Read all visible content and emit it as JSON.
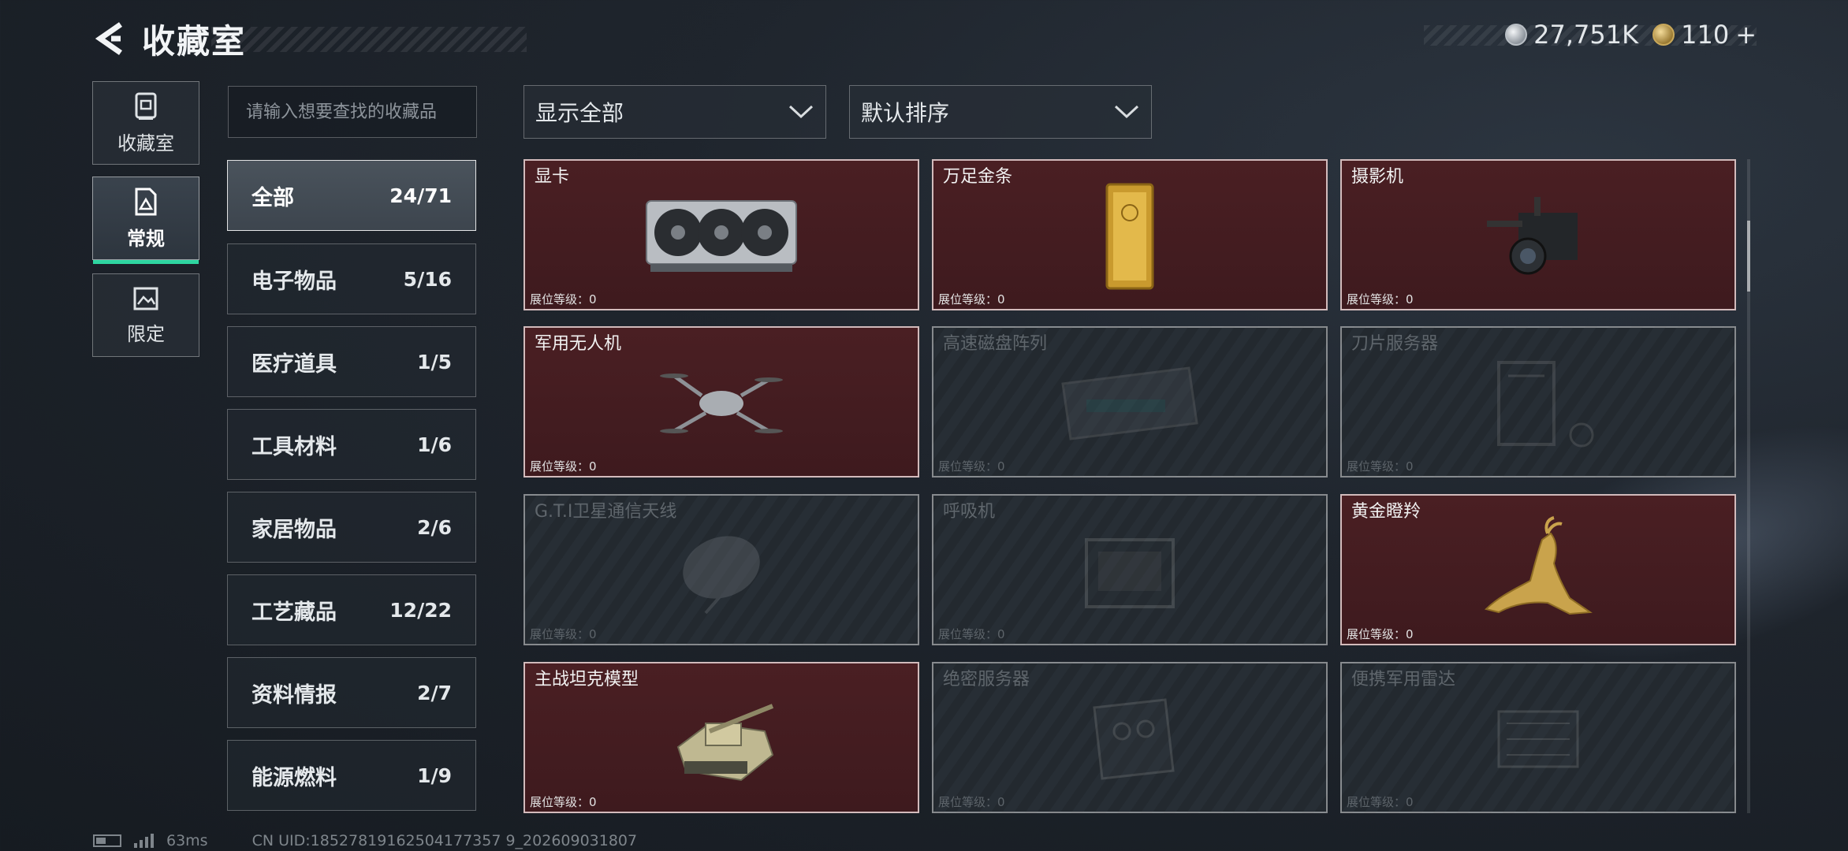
{
  "header": {
    "title": "收藏室",
    "back_icon": "back-arrow-icon"
  },
  "currency": [
    {
      "icon": "silver-coin-icon",
      "value": "27,751K"
    },
    {
      "icon": "gold-coin-icon",
      "value": "110",
      "add_symbol": "+"
    }
  ],
  "left_tabs": [
    {
      "label": "收藏室",
      "icon": "vault-icon",
      "active": false
    },
    {
      "label": "常规",
      "icon": "document-icon",
      "active": true
    },
    {
      "label": "限定",
      "icon": "picture-icon",
      "active": false
    }
  ],
  "search": {
    "placeholder": "请输入想要查找的收藏品"
  },
  "categories": [
    {
      "name": "全部",
      "count": "24/71",
      "active": true
    },
    {
      "name": "电子物品",
      "count": "5/16"
    },
    {
      "name": "医疗道具",
      "count": "1/5"
    },
    {
      "name": "工具材料",
      "count": "1/6"
    },
    {
      "name": "家居物品",
      "count": "2/6"
    },
    {
      "name": "工艺藏品",
      "count": "12/22"
    },
    {
      "name": "资料情报",
      "count": "2/7"
    },
    {
      "name": "能源燃料",
      "count": "1/9"
    }
  ],
  "filters": {
    "display": {
      "value": "显示全部",
      "icon": "chevron-down-icon"
    },
    "sort": {
      "value": "默认排序",
      "icon": "chevron-down-icon"
    }
  },
  "level_label": "展位等级：",
  "items": [
    {
      "name": "显卡",
      "level": "0",
      "owned": true,
      "icon": "graphics-card-icon"
    },
    {
      "name": "万足金条",
      "level": "0",
      "owned": true,
      "icon": "gold-bar-icon"
    },
    {
      "name": "摄影机",
      "level": "0",
      "owned": true,
      "icon": "video-camera-icon"
    },
    {
      "name": "军用无人机",
      "level": "0",
      "owned": true,
      "icon": "drone-icon"
    },
    {
      "name": "高速磁盘阵列",
      "level": "0",
      "owned": false,
      "icon": "disk-array-icon"
    },
    {
      "name": "刀片服务器",
      "level": "0",
      "owned": false,
      "icon": "blade-server-icon"
    },
    {
      "name": "G.T.I卫星通信天线",
      "level": "0",
      "owned": false,
      "icon": "satellite-dish-icon"
    },
    {
      "name": "呼吸机",
      "level": "0",
      "owned": false,
      "icon": "ventilator-icon"
    },
    {
      "name": "黄金瞪羚",
      "level": "0",
      "owned": true,
      "icon": "golden-gazelle-icon"
    },
    {
      "name": "主战坦克模型",
      "level": "0",
      "owned": true,
      "icon": "tank-model-icon"
    },
    {
      "name": "绝密服务器",
      "level": "0",
      "owned": false,
      "icon": "server-icon"
    },
    {
      "name": "便携军用雷达",
      "level": "0",
      "owned": false,
      "icon": "radar-icon"
    }
  ],
  "footer": {
    "ping": "63ms",
    "uid": "CN UID:18527819162504177357 9_202609031807"
  }
}
